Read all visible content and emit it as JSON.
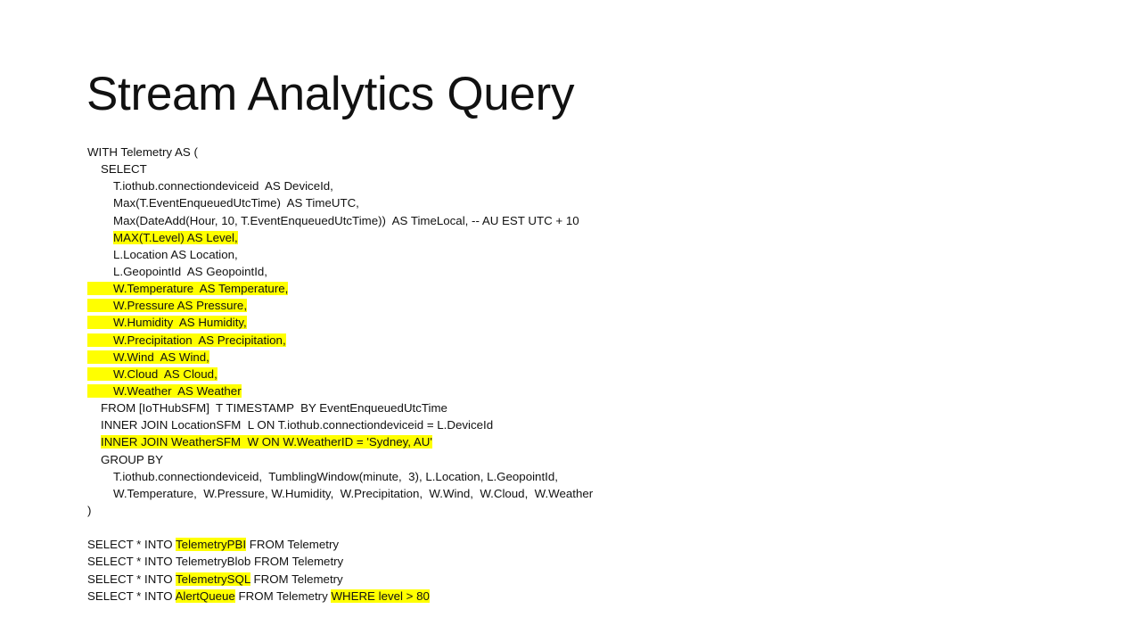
{
  "title": "Stream Analytics Query",
  "query": {
    "with_open": "WITH Telemetry AS (",
    "select": "SELECT",
    "col_device": "T.iothub.connectiondeviceid  AS DeviceId,",
    "col_time_utc": "Max(T.EventEnqueuedUtcTime)  AS TimeUTC,",
    "col_time_local": "Max(DateAdd(Hour, 10, T.EventEnqueuedUtcTime))  AS TimeLocal, -- AU EST UTC + 10",
    "col_level": "MAX(T.Level) AS Level,",
    "col_location": "L.Location AS Location,",
    "col_geopoint": "L.GeopointId  AS GeopointId,",
    "col_temperature": "W.Temperature  AS Temperature,",
    "col_pressure": "W.Pressure AS Pressure,",
    "col_humidity": "W.Humidity  AS Humidity,",
    "col_precipitation": "W.Precipitation  AS Precipitation,",
    "col_wind": "W.Wind  AS Wind,",
    "col_cloud": "W.Cloud  AS Cloud,",
    "col_weather": "W.Weather  AS Weather",
    "from": "FROM [IoTHubSFM]  T TIMESTAMP  BY EventEnqueuedUtcTime",
    "join_location": "INNER JOIN LocationSFM  L ON T.iothub.connectiondeviceid = L.DeviceId",
    "join_weather": "INNER JOIN WeatherSFM  W ON W.WeatherID = 'Sydney, AU'",
    "group_by": "GROUP BY",
    "group_cols_1": "T.iothub.connectiondeviceid,  TumblingWindow(minute,  3), L.Location, L.GeopointId,",
    "group_cols_2": "W.Temperature,  W.Pressure, W.Humidity,  W.Precipitation,  W.Wind,  W.Cloud,  W.Weather",
    "close_paren": ")"
  },
  "outputs": [
    {
      "prefix": "SELECT * INTO ",
      "target": "TelemetryPBI",
      "suffix": " FROM Telemetry",
      "target_highlighted": true,
      "where": ""
    },
    {
      "prefix": "SELECT * INTO ",
      "target": "TelemetryBlob",
      "suffix": " FROM Telemetry",
      "target_highlighted": false,
      "where": ""
    },
    {
      "prefix": "SELECT * INTO ",
      "target": "TelemetrySQL",
      "suffix": " FROM Telemetry",
      "target_highlighted": true,
      "where": ""
    },
    {
      "prefix": "SELECT * INTO ",
      "target": "AlertQueue",
      "suffix": " FROM Telemetry ",
      "target_highlighted": true,
      "where": "WHERE level > 80"
    }
  ],
  "highlight_color": "#ffff00"
}
